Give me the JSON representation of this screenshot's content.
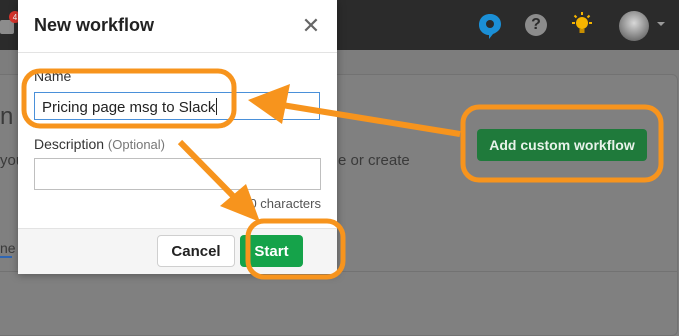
{
  "topbar": {
    "badge_count": "4",
    "help_glyph": "?",
    "icons": [
      "app-logo-icon",
      "help-icon",
      "lightbulb-icon",
      "avatar",
      "chevron-down-icon",
      "notification-badge-icon"
    ]
  },
  "background": {
    "heading_fragment": "n",
    "text_fragment_left": "you",
    "text_fragment_right": "e or create",
    "tab_fragment": "ne",
    "add_custom_workflow_label": "Add custom workflow"
  },
  "modal": {
    "title": "New workflow",
    "close_glyph": "✕",
    "name_label": "Name",
    "name_value": "Pricing page msg to Slack",
    "description_label": "Description",
    "description_optional": "(Optional)",
    "description_value": "",
    "char_count": "20 characters",
    "cancel_label": "Cancel",
    "start_label": "Start"
  },
  "colors": {
    "annotation_orange": "#f7941d",
    "start_green": "#15a34a",
    "add_button_green": "#1f7a3b",
    "topbar": "#2b2b2b",
    "input_focus": "#4a90d9"
  }
}
